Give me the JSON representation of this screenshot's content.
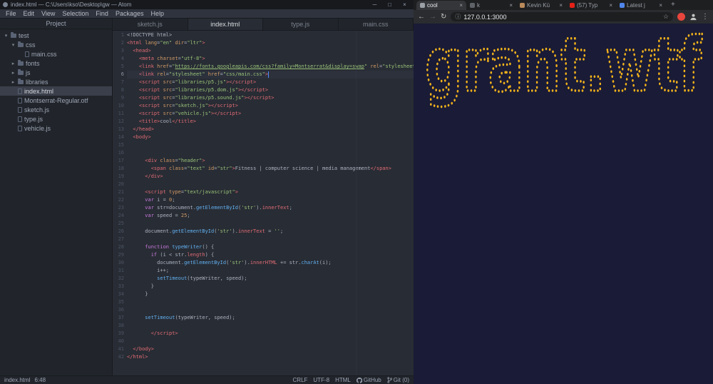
{
  "icons": {
    "minimize": "─",
    "maximize": "□",
    "close": "×",
    "chevron_down": "▾",
    "chevron_right": "▸",
    "back": "←",
    "forward": "→",
    "reload": "↻",
    "info": "ⓘ",
    "star": "☆",
    "menu_dots": "⋮",
    "new_tab": "+",
    "tab_close": "×"
  },
  "atom": {
    "window_title": "index.html — C:\\Users\\kso\\Desktop\\gw — Atom",
    "menu": [
      "File",
      "Edit",
      "View",
      "Selection",
      "Find",
      "Packages",
      "Help"
    ],
    "project_header": "Project",
    "tree": [
      {
        "label": "test",
        "type": "folder",
        "expanded": true,
        "depth": 0
      },
      {
        "label": "css",
        "type": "folder",
        "expanded": true,
        "depth": 1
      },
      {
        "label": "main.css",
        "type": "file",
        "depth": 2
      },
      {
        "label": "fonts",
        "type": "folder",
        "expanded": false,
        "depth": 1
      },
      {
        "label": "js",
        "type": "folder",
        "expanded": false,
        "depth": 1
      },
      {
        "label": "libraries",
        "type": "folder",
        "expanded": false,
        "depth": 1
      },
      {
        "label": "index.html",
        "type": "file",
        "depth": 1,
        "selected": true
      },
      {
        "label": "Montserrat-Regular.otf",
        "type": "file",
        "depth": 1
      },
      {
        "label": "sketch.js",
        "type": "file",
        "depth": 1
      },
      {
        "label": "type.js",
        "type": "file",
        "depth": 1
      },
      {
        "label": "vehicle.js",
        "type": "file",
        "depth": 1
      }
    ],
    "editor_tabs": [
      {
        "label": "sketch.js",
        "active": false
      },
      {
        "label": "index.html",
        "active": true
      },
      {
        "label": "type.js",
        "active": false
      },
      {
        "label": "main.css",
        "active": false
      }
    ],
    "active_line": 6,
    "code_lines": [
      [
        [
          "p",
          "<!DOCTYPE html>"
        ]
      ],
      [
        [
          "t",
          "<html"
        ],
        [
          "a",
          " lang"
        ],
        [
          "p",
          "="
        ],
        [
          "s",
          "\"en\""
        ],
        [
          "a",
          " dir"
        ],
        [
          "p",
          "="
        ],
        [
          "s",
          "\"ltr\""
        ],
        [
          "t",
          ">"
        ]
      ],
      [
        [
          "t",
          "  <head>"
        ]
      ],
      [
        [
          "t",
          "    <meta"
        ],
        [
          "a",
          " charset"
        ],
        [
          "p",
          "="
        ],
        [
          "s",
          "\"utf-8\""
        ],
        [
          "t",
          ">"
        ]
      ],
      [
        [
          "t",
          "    <link"
        ],
        [
          "a",
          " href"
        ],
        [
          "p",
          "="
        ],
        [
          "s",
          "\""
        ],
        [
          "u",
          "https://fonts.googleapis.com/css?family=Montserrat&display=swap"
        ],
        [
          "s",
          "\""
        ],
        [
          "a",
          " rel"
        ],
        [
          "p",
          "="
        ],
        [
          "s",
          "\"stylesheet\""
        ],
        [
          "t",
          ">"
        ]
      ],
      [
        [
          "t",
          "    <link"
        ],
        [
          "a",
          " rel"
        ],
        [
          "p",
          "="
        ],
        [
          "s",
          "\"stylesheet\""
        ],
        [
          "a",
          " href"
        ],
        [
          "p",
          "="
        ],
        [
          "s",
          "\"css/main.css\""
        ],
        [
          "t",
          ">"
        ]
      ],
      [
        [
          "t",
          "    <script"
        ],
        [
          "a",
          " src"
        ],
        [
          "p",
          "="
        ],
        [
          "s",
          "\"libraries/p5.js\""
        ],
        [
          "t",
          "></script>"
        ]
      ],
      [
        [
          "t",
          "    <script"
        ],
        [
          "a",
          " src"
        ],
        [
          "p",
          "="
        ],
        [
          "s",
          "\"libraries/p5.dom.js\""
        ],
        [
          "t",
          "></script>"
        ]
      ],
      [
        [
          "t",
          "    <script"
        ],
        [
          "a",
          " src"
        ],
        [
          "p",
          "="
        ],
        [
          "s",
          "\"libraries/p5.sound.js\""
        ],
        [
          "t",
          "></script>"
        ]
      ],
      [
        [
          "t",
          "    <script"
        ],
        [
          "a",
          " src"
        ],
        [
          "p",
          "="
        ],
        [
          "s",
          "\"sketch.js\""
        ],
        [
          "t",
          "></script>"
        ]
      ],
      [
        [
          "t",
          "    <script"
        ],
        [
          "a",
          " src"
        ],
        [
          "p",
          "="
        ],
        [
          "s",
          "\"vehicle.js\""
        ],
        [
          "t",
          "></script>"
        ]
      ],
      [
        [
          "t",
          "    <title>"
        ],
        [
          "p",
          "cool"
        ],
        [
          "t",
          "</title>"
        ]
      ],
      [
        [
          "t",
          "  </head>"
        ]
      ],
      [
        [
          "t",
          "  <body>"
        ]
      ],
      [],
      [],
      [
        [
          "t",
          "      <div"
        ],
        [
          "a",
          " class"
        ],
        [
          "p",
          "="
        ],
        [
          "s",
          "\"header\""
        ],
        [
          "t",
          ">"
        ]
      ],
      [
        [
          "t",
          "        <span"
        ],
        [
          "a",
          " class"
        ],
        [
          "p",
          "="
        ],
        [
          "s",
          "\"text\""
        ],
        [
          "a",
          " id"
        ],
        [
          "p",
          "="
        ],
        [
          "s",
          "\"str\""
        ],
        [
          "t",
          ">"
        ],
        [
          "p",
          "Fitness | computer science | media management"
        ],
        [
          "t",
          "</span>"
        ]
      ],
      [
        [
          "t",
          "      </div>"
        ]
      ],
      [],
      [
        [
          "t",
          "      <script"
        ],
        [
          "a",
          " type"
        ],
        [
          "p",
          "="
        ],
        [
          "s",
          "\"text/javascript\""
        ],
        [
          "t",
          ">"
        ]
      ],
      [
        [
          "k",
          "      var"
        ],
        [
          "p",
          " i = "
        ],
        [
          "n",
          "0"
        ],
        [
          "p",
          ";"
        ]
      ],
      [
        [
          "k",
          "      var"
        ],
        [
          "p",
          " str=document."
        ],
        [
          "f",
          "getElementById"
        ],
        [
          "p",
          "("
        ],
        [
          "s",
          "'str'"
        ],
        [
          "p",
          ")."
        ],
        [
          "t",
          "innerText"
        ],
        [
          "p",
          ";"
        ]
      ],
      [
        [
          "k",
          "      var"
        ],
        [
          "p",
          " speed = "
        ],
        [
          "n",
          "25"
        ],
        [
          "p",
          ";"
        ]
      ],
      [],
      [
        [
          "p",
          "      document."
        ],
        [
          "f",
          "getElementById"
        ],
        [
          "p",
          "("
        ],
        [
          "s",
          "'str'"
        ],
        [
          "p",
          ")."
        ],
        [
          "t",
          "innerText"
        ],
        [
          "p",
          " = "
        ],
        [
          "s",
          "''"
        ],
        [
          "p",
          ";"
        ]
      ],
      [],
      [
        [
          "k",
          "      function "
        ],
        [
          "f",
          "typeWriter"
        ],
        [
          "p",
          "() {"
        ]
      ],
      [
        [
          "k",
          "        if"
        ],
        [
          "p",
          " (i < str."
        ],
        [
          "t",
          "length"
        ],
        [
          "p",
          ") {"
        ]
      ],
      [
        [
          "p",
          "          document."
        ],
        [
          "f",
          "getElementById"
        ],
        [
          "p",
          "("
        ],
        [
          "s",
          "'str'"
        ],
        [
          "p",
          ")."
        ],
        [
          "t",
          "innerHTML"
        ],
        [
          "p",
          " += str."
        ],
        [
          "f",
          "charAt"
        ],
        [
          "p",
          "(i);"
        ]
      ],
      [
        [
          "p",
          "          i++;"
        ]
      ],
      [
        [
          "f",
          "          setTimeout"
        ],
        [
          "p",
          "(typeWriter, speed);"
        ]
      ],
      [
        [
          "p",
          "        }"
        ]
      ],
      [
        [
          "p",
          "      }"
        ]
      ],
      [],
      [],
      [
        [
          "f",
          "      setTimeout"
        ],
        [
          "p",
          "(typeWriter, speed);"
        ]
      ],
      [],
      [
        [
          "t",
          "        </script>"
        ]
      ],
      [],
      [
        [
          "t",
          "  </body>"
        ]
      ],
      [
        [
          "t",
          "</html>"
        ]
      ]
    ],
    "status": {
      "file": "index.html",
      "position": "6:48",
      "right": [
        "CRLF",
        "UTF-8",
        "HTML",
        "GitHub",
        "Git (0)"
      ]
    }
  },
  "browser": {
    "tabs": [
      {
        "label": "cool",
        "favicon_color": "#9aa0a6",
        "active": true
      },
      {
        "label": "k",
        "favicon_color": "#5f6368",
        "active": false
      },
      {
        "label": "Kevin Kü",
        "favicon_color": "#b98a5a",
        "active": false
      },
      {
        "label": "(57) Typ",
        "favicon_color": "#e62117",
        "active": false
      },
      {
        "label": "Latest j",
        "favicon_color": "#4f86ec",
        "active": false
      }
    ],
    "url": "127.0.0.1:3000",
    "page": {
      "text": "grant.wtf",
      "background": "#1a1b36",
      "dot_color": "#f3b31b"
    }
  }
}
